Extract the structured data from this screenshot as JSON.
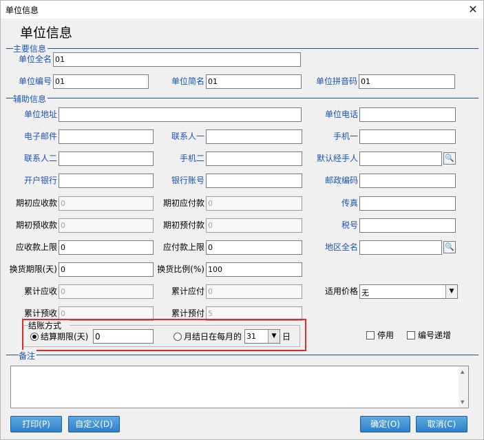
{
  "window": {
    "title": "单位信息",
    "close_glyph": "✕"
  },
  "heading": "单位信息",
  "sections": {
    "main": "主要信息",
    "aux": "辅助信息",
    "remark": "备注"
  },
  "main": {
    "full_name": {
      "label": "单位全名",
      "value": "01"
    },
    "code": {
      "label": "单位编号",
      "value": "01"
    },
    "short_name": {
      "label": "单位简名",
      "value": "01"
    },
    "pinyin": {
      "label": "单位拼音码",
      "value": "01"
    }
  },
  "aux": {
    "address": {
      "label": "单位地址",
      "value": ""
    },
    "phone": {
      "label": "单位电话",
      "value": ""
    },
    "email": {
      "label": "电子邮件",
      "value": ""
    },
    "contact1": {
      "label": "联系人一",
      "value": ""
    },
    "mobile1": {
      "label": "手机一",
      "value": ""
    },
    "contact2": {
      "label": "联系人二",
      "value": ""
    },
    "mobile2": {
      "label": "手机二",
      "value": ""
    },
    "handler": {
      "label": "默认经手人",
      "value": ""
    },
    "bank": {
      "label": "开户银行",
      "value": ""
    },
    "account": {
      "label": "银行账号",
      "value": ""
    },
    "postcode": {
      "label": "邮政编码",
      "value": ""
    },
    "init_recv": {
      "label": "期初应收款",
      "value": "0"
    },
    "init_pay": {
      "label": "期初应付款",
      "value": "0"
    },
    "fax": {
      "label": "传真",
      "value": ""
    },
    "init_prerecv": {
      "label": "期初预收款",
      "value": "0"
    },
    "init_prepay": {
      "label": "期初预付款",
      "value": "0"
    },
    "tax_no": {
      "label": "税号",
      "value": ""
    },
    "recv_limit": {
      "label": "应收款上限",
      "value": "0"
    },
    "pay_limit": {
      "label": "应付款上限",
      "value": "0"
    },
    "region": {
      "label": "地区全名",
      "value": ""
    },
    "exch_days": {
      "label": "换货期限(天)",
      "value": "0"
    },
    "exch_ratio": {
      "label": "换货比例(%)",
      "value": "100"
    },
    "acc_recv": {
      "label": "累计应收",
      "value": "0"
    },
    "acc_pay": {
      "label": "累计应付",
      "value": "0"
    },
    "price": {
      "label": "适用价格",
      "value": "无"
    },
    "acc_prerecv": {
      "label": "累计预收",
      "value": "0"
    },
    "acc_prepay": {
      "label": "累计预付",
      "value": "5"
    }
  },
  "settlement": {
    "legend": "结账方式",
    "opt_days": {
      "label": "结算期限(天)",
      "value": "0"
    },
    "opt_month": {
      "label": "月结日在每月的",
      "value": "31",
      "suffix": "日"
    }
  },
  "checks": {
    "disabled": "停用",
    "auto_inc": "编号递增"
  },
  "icons": {
    "lookup": "🔍",
    "dropdown": "▼",
    "scroll_up": "▲",
    "scroll_down": "▼"
  },
  "buttons": {
    "print": "打印(P)",
    "custom": "自定义(D)",
    "ok": "确定(O)",
    "cancel": "取消(C)"
  }
}
